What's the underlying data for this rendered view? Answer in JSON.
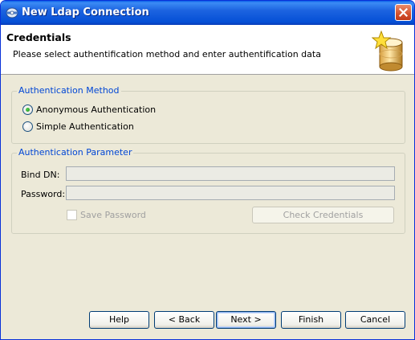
{
  "window": {
    "title": "New Ldap Connection",
    "close_icon": "close-icon"
  },
  "header": {
    "title": "Credentials",
    "description": "Please select authentification method and enter authentification data",
    "icon": "database-star-icon"
  },
  "auth_method": {
    "legend": "Authentication Method",
    "options": [
      {
        "label": "Anonymous Authentication",
        "selected": true
      },
      {
        "label": "Simple Authentication",
        "selected": false
      }
    ]
  },
  "auth_param": {
    "legend": "Authentication Parameter",
    "bind_dn_label": "Bind DN:",
    "bind_dn_value": "",
    "password_label": "Password:",
    "password_value": "",
    "save_password_label": "Save Password",
    "save_password_checked": false,
    "check_credentials_label": "Check Credentials"
  },
  "buttons": {
    "help": "Help",
    "back": "< Back",
    "next": "Next >",
    "finish": "Finish",
    "cancel": "Cancel"
  },
  "colors": {
    "titlebar": "#0550d6",
    "legend": "#0046d5",
    "dialog_bg": "#ece9d8"
  }
}
